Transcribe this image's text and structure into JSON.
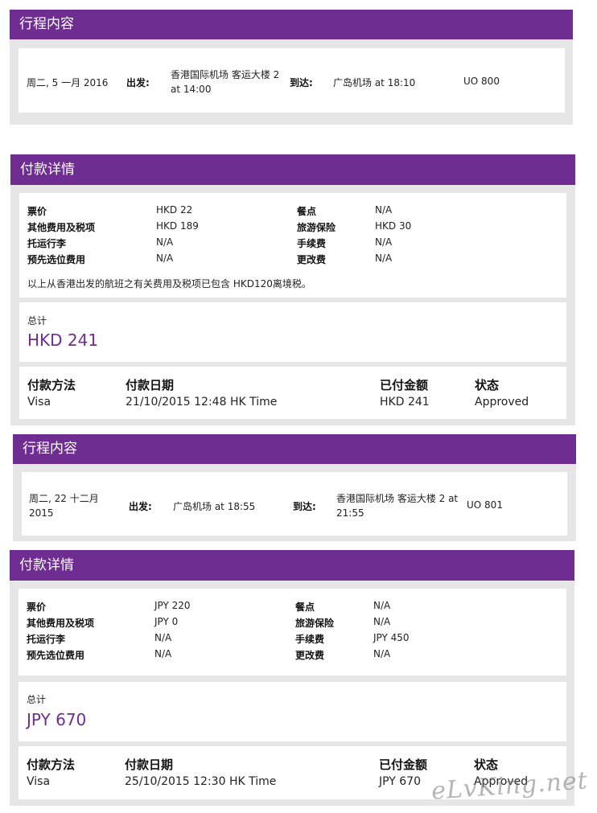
{
  "trip1": {
    "section_title": "行程内容",
    "date": "周二, 5 一月 2016",
    "depart_label": "出发:",
    "depart_line1": "香港国际机场 客运大楼 2",
    "depart_line2": "at 14:00",
    "arrive_label": "到达:",
    "arrive_value": "广岛机场 at 18:10",
    "flight_no": "UO 800"
  },
  "payment1": {
    "section_title": "付款详情",
    "fees": [
      {
        "label": "票价",
        "value": "HKD 22"
      },
      {
        "label": "其他费用及税项",
        "value": "HKD 189"
      },
      {
        "label": "托运行李",
        "value": "N/A"
      },
      {
        "label": "预先选位费用",
        "value": "N/A"
      },
      {
        "label": "餐点",
        "value": "N/A"
      },
      {
        "label": "旅游保险",
        "value": "HKD 30"
      },
      {
        "label": "手续费",
        "value": "N/A"
      },
      {
        "label": "更改费",
        "value": "N/A"
      }
    ],
    "tax_note": "以上从香港出发的航班之有关费用及税项已包含 HKD120离境税。",
    "total_label": "总计",
    "total_value": "HKD 241",
    "columns": [
      "付款方法",
      "付款日期",
      "已付金额",
      "状态"
    ],
    "row": [
      "Visa",
      "21/10/2015 12:48 HK Time",
      "HKD 241",
      "Approved"
    ]
  },
  "trip2": {
    "section_title": "行程内容",
    "date_line1": "周二, 22 十二月",
    "date_line2": "2015",
    "depart_label": "出发:",
    "depart_value": "广岛机场 at 18:55",
    "arrive_label": "到达:",
    "arrive_line1": "香港国际机场 客运大楼 2 at",
    "arrive_line2": "21:55",
    "flight_no": "UO 801"
  },
  "payment2": {
    "section_title": "付款详情",
    "fees": [
      {
        "label": "票价",
        "value": "JPY 220"
      },
      {
        "label": "其他费用及税项",
        "value": "JPY 0"
      },
      {
        "label": "托运行李",
        "value": "N/A"
      },
      {
        "label": "预先选位费用",
        "value": "N/A"
      },
      {
        "label": "餐点",
        "value": "N/A"
      },
      {
        "label": "旅游保险",
        "value": "N/A"
      },
      {
        "label": "手续费",
        "value": "JPY 450"
      },
      {
        "label": "更改费",
        "value": "N/A"
      }
    ],
    "total_label": "总计",
    "total_value": "JPY 670",
    "columns": [
      "付款方法",
      "付款日期",
      "已付金额",
      "状态"
    ],
    "row": [
      "Visa",
      "25/10/2015 12:30 HK Time",
      "JPY 670",
      "Approved"
    ]
  },
  "watermark": "eLvKing.net",
  "colors": {
    "accent": "#6f2c91",
    "panel": "#e6e6e6"
  }
}
